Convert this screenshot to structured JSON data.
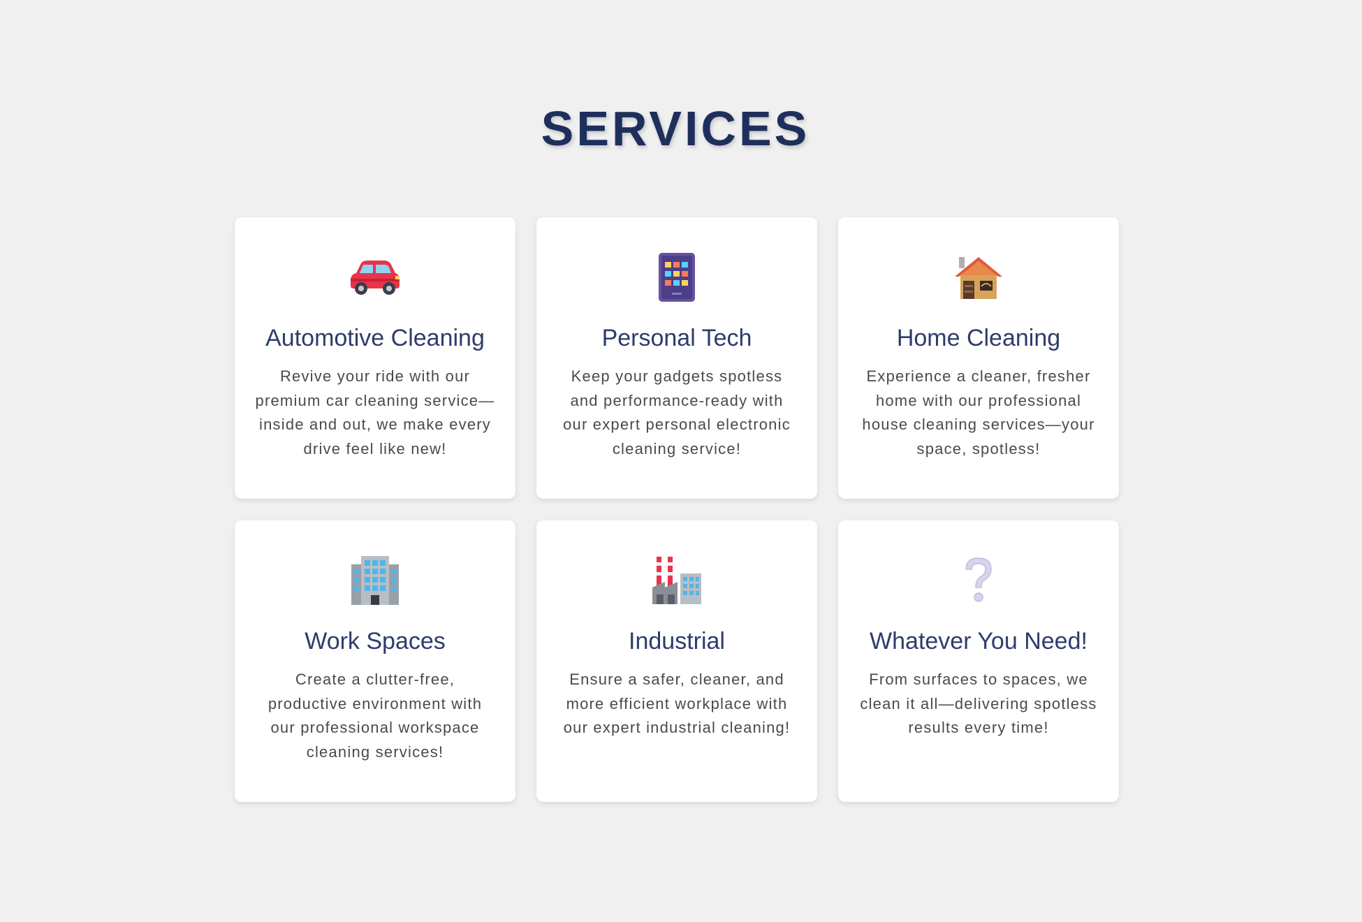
{
  "heading": "SERVICES",
  "colors": {
    "background": "#f0f0f1",
    "title": "#1f2f5c",
    "card_title": "#2e3c6b",
    "card_text": "#4a4a4a",
    "card_bg": "#ffffff"
  },
  "services": [
    {
      "icon": "car-icon",
      "title": "Automotive Cleaning",
      "description": "Revive your ride with our premium car cleaning service—inside and out, we make every drive feel like new!"
    },
    {
      "icon": "tablet-icon",
      "title": "Personal Tech",
      "description": "Keep your gadgets spotless and performance-ready with our expert personal electronic cleaning service!"
    },
    {
      "icon": "house-icon",
      "title": "Home Cleaning",
      "description": "Experience a cleaner, fresher home with our professional house cleaning services—your space, spotless!"
    },
    {
      "icon": "office-building-icon",
      "title": "Work Spaces",
      "description": "Create a clutter-free, productive environment with our professional workspace cleaning services!"
    },
    {
      "icon": "factory-icon",
      "title": "Industrial",
      "description": "Ensure a safer, cleaner, and more efficient workplace with our expert industrial cleaning!"
    },
    {
      "icon": "question-mark-icon",
      "title": "Whatever You Need!",
      "description": "From surfaces to spaces, we clean it all—delivering spotless results every time!"
    }
  ]
}
